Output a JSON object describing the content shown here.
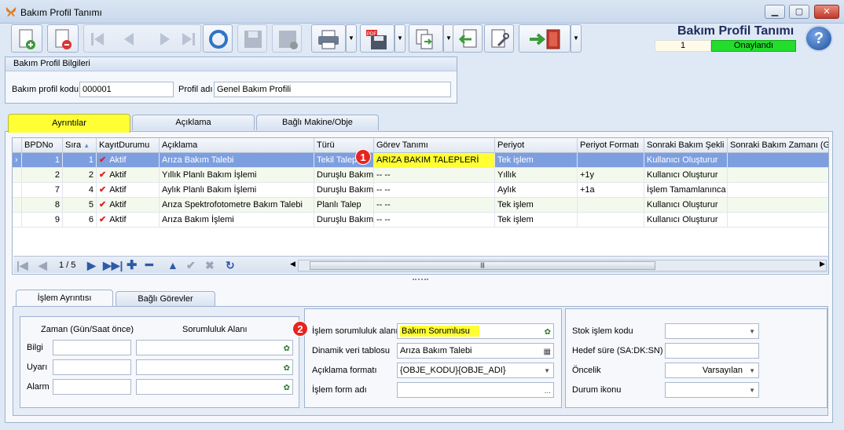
{
  "window": {
    "title": "Bakım Profil Tanımı",
    "controls": {
      "minimize": "▁",
      "maximize": "▢",
      "close": "✕"
    }
  },
  "header": {
    "heading": "Bakım Profil Tanımı",
    "record_no": "1",
    "status": "Onaylandı",
    "help": "?"
  },
  "profile_group": {
    "title": "Bakım Profil Bilgileri",
    "code_label": "Bakım profil kodu",
    "code_value": "000001",
    "name_label": "Profil adı",
    "name_value": "Genel Bakım Profili"
  },
  "tabs": {
    "details": "Ayrıntılar",
    "description": "Açıklama",
    "linked": "Bağlı Makine/Obje"
  },
  "grid": {
    "columns": [
      "BPDNo",
      "Sıra",
      "KayıtDurumu",
      "Açıklama",
      "Türü",
      "Görev Tanımı",
      "Periyot",
      "Periyot Formatı",
      "Sonraki Bakım Şekli",
      "Sonraki Bakım Zamanı (Gün"
    ],
    "rows": [
      [
        "1",
        "1",
        "Aktif",
        "Arıza Bakım Talebi",
        "Tekil Talep",
        "ARIZA BAKIM TALEPLERİ",
        "Tek işlem",
        "",
        "Kullanıcı Oluşturur",
        ""
      ],
      [
        "2",
        "2",
        "Aktif",
        "Yıllık Planlı Bakım İşlemi",
        "Duruşlu Bakım",
        "-- --",
        "Yıllık",
        "+1y",
        "Kullanıcı Oluşturur",
        ""
      ],
      [
        "7",
        "4",
        "Aktif",
        "Aylık Planlı Bakım İşlemi",
        "Duruşlu Bakım",
        "-- --",
        "Aylık",
        "+1a",
        "İşlem Tamamlanınca",
        ""
      ],
      [
        "8",
        "5",
        "Aktif",
        "Arıza Spektrofotometre Bakım Talebi",
        "Planlı Talep",
        "-- --",
        "Tek işlem",
        "",
        "Kullanıcı Oluşturur",
        ""
      ],
      [
        "9",
        "6",
        "Aktif",
        "Arıza Bakım İşlemi",
        "Duruşlu Bakım",
        "-- --",
        "Tek işlem",
        "",
        "Kullanıcı Oluşturur",
        ""
      ]
    ],
    "pager": "1 / 5",
    "row_indicator": "›",
    "sort_arrow": "▲",
    "scroll_grip": "|||"
  },
  "markers": {
    "one": "1",
    "two": "2"
  },
  "lower_tabs": {
    "operation": "İşlem Ayrıntısı",
    "linked": "Bağlı Görevler"
  },
  "left_box": {
    "time_header": "Zaman (Gün/Saat önce)",
    "area_header": "Sorumluluk Alanı",
    "rows": [
      "Bilgi",
      "Uyarı",
      "Alarm"
    ]
  },
  "mid_box": {
    "resp_label": "İşlem sorumluluk alanı",
    "resp_value": "Bakım Sorumlusu",
    "table_label": "Dinamik veri tablosu",
    "table_value": "Arıza Bakım Talebi",
    "format_label": "Açıklama formatı",
    "format_value": "{OBJE_KODU}{OBJE_ADI}",
    "form_label": "İşlem form adı",
    "form_value": "",
    "ellipsis": "..."
  },
  "right_box": {
    "stock_label": "Stok işlem kodu",
    "stock_value": "",
    "target_label": "Hedef süre (SA:DK:SN)",
    "target_value": "",
    "priority_label": "Öncelik",
    "priority_value": "Varsayılan",
    "status_icon_label": "Durum ikonu",
    "status_icon_value": ""
  },
  "colors": {
    "highlight": "#ffff33",
    "status_green": "#22dd2b",
    "selected_row": "#7d9fe0",
    "marker": "#e8241e"
  }
}
